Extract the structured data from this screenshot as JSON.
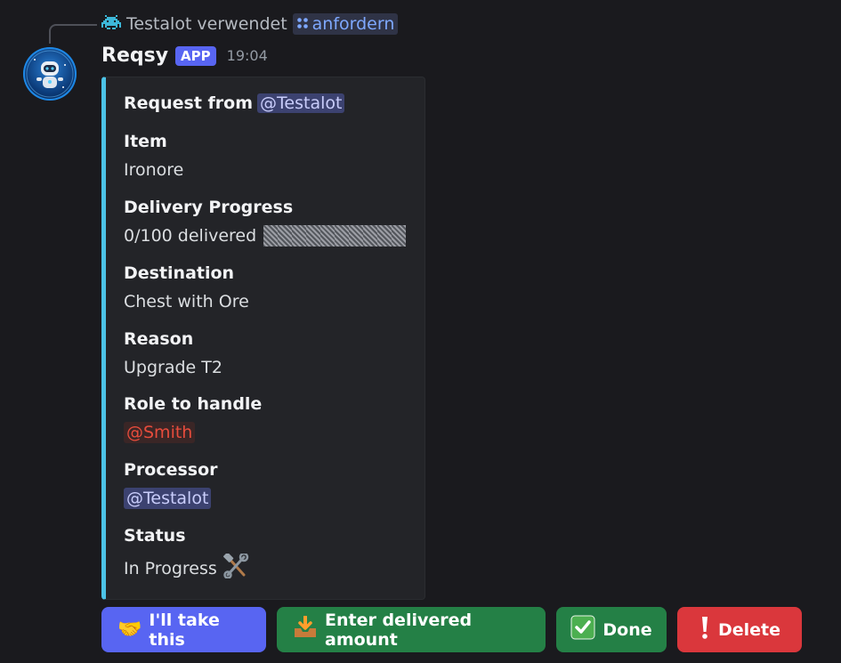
{
  "reply": {
    "user": "Testalot",
    "verb": "verwendet",
    "command": "anfordern",
    "user_icon": "space-invader-icon",
    "command_icon": "slash-command-icon"
  },
  "message": {
    "author": "Reqsy",
    "badge": "APP",
    "timestamp": "19:04",
    "avatar_icon": "robot-avatar"
  },
  "embed": {
    "accent_color": "#4cc3e7",
    "title_prefix": "Request from",
    "title_mention": "@Testalot",
    "fields": {
      "item": {
        "name": "Item",
        "value": "Ironore"
      },
      "progress": {
        "name": "Delivery Progress",
        "value": "0/100 delivered",
        "fraction": 0
      },
      "destination": {
        "name": "Destination",
        "value": "Chest with Ore"
      },
      "reason": {
        "name": "Reason",
        "value": "Upgrade T2"
      },
      "role": {
        "name": "Role to handle",
        "value": "@Smith"
      },
      "processor": {
        "name": "Processor",
        "value": "@Testalot"
      },
      "status": {
        "name": "Status",
        "value": "In Progress",
        "icon": "hammer-wrench-icon"
      }
    }
  },
  "buttons": {
    "take": {
      "label": "I'll take this",
      "icon": "handshake-icon",
      "color": "#5865f2"
    },
    "enter": {
      "label": "Enter delivered amount",
      "icon": "inbox-tray-icon",
      "color": "#248046"
    },
    "done": {
      "label": "Done",
      "icon": "check-mark-icon",
      "color": "#248046"
    },
    "delete": {
      "label": "Delete",
      "icon": "exclamation-icon",
      "color": "#da373c"
    }
  }
}
